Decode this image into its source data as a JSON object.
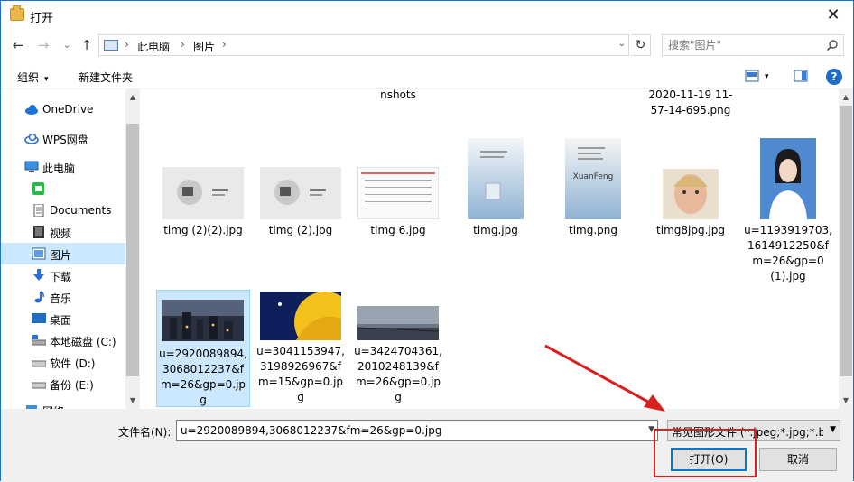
{
  "window": {
    "title": "打开",
    "close_label": "✕"
  },
  "nav": {
    "back": "←",
    "forward": "→",
    "history": "⌄",
    "up": "↑",
    "refresh": "↻"
  },
  "address": {
    "crumbs": [
      "此电脑",
      "图片"
    ],
    "sep": "›",
    "drop": "⌄"
  },
  "search": {
    "placeholder": "搜索\"图片\""
  },
  "toolbar": {
    "organize": "组织",
    "new_folder": "新建文件夹",
    "caret": "▾",
    "help": "?"
  },
  "sidebar": {
    "items": [
      {
        "label": "OneDrive",
        "icon": "cloud-icon"
      },
      {
        "label": "WPS网盘",
        "icon": "wps-cloud-icon"
      },
      {
        "label": "此电脑",
        "icon": "computer-icon"
      },
      {
        "label": "",
        "icon": "green-app-icon"
      },
      {
        "label": "Documents",
        "icon": "document-icon"
      },
      {
        "label": "视频",
        "icon": "video-icon"
      },
      {
        "label": "图片",
        "icon": "pictures-icon",
        "selected": true
      },
      {
        "label": "下载",
        "icon": "download-icon"
      },
      {
        "label": "音乐",
        "icon": "music-icon"
      },
      {
        "label": "桌面",
        "icon": "desktop-icon"
      },
      {
        "label": "本地磁盘 (C:)",
        "icon": "system-drive-icon"
      },
      {
        "label": "软件 (D:)",
        "icon": "drive-icon"
      },
      {
        "label": "备份 (E:)",
        "icon": "drive-icon"
      },
      {
        "label": "网络",
        "icon": "network-icon"
      }
    ]
  },
  "files_top": [
    {
      "name": "nshots"
    },
    {
      "name": "2020-11-19 11-57-14-695.png"
    }
  ],
  "files": [
    {
      "name": "timg (2)(2).jpg"
    },
    {
      "name": "timg (2).jpg"
    },
    {
      "name": "timg 6.jpg"
    },
    {
      "name": "timg.jpg"
    },
    {
      "name": "timg.png",
      "overlay": "XuanFeng"
    },
    {
      "name": "timg8jpg.jpg"
    },
    {
      "name": "u=1193919703,1614912250&fm=26&gp=0(1).jpg"
    },
    {
      "name": "u=2920089894,3068012237&fm=26&gp=0.jpg",
      "selected": true
    },
    {
      "name": "u=3041153947,3198926967&fm=15&gp=0.jpg"
    },
    {
      "name": "u=3424704361,2010248139&fm=26&gp=0.jpg"
    }
  ],
  "footer": {
    "filename_label": "文件名(N):",
    "filename_value": "u=2920089894,3068012237&fm=26&gp=0.jpg",
    "filetype_value": "常见图形文件 (*.jpeg;*.jpg;*.b",
    "open_label": "打开(O)",
    "cancel_label": "取消"
  },
  "colors": {
    "selection": "#cce8ff",
    "accent": "#0078d7",
    "annotation": "#d9201f"
  }
}
